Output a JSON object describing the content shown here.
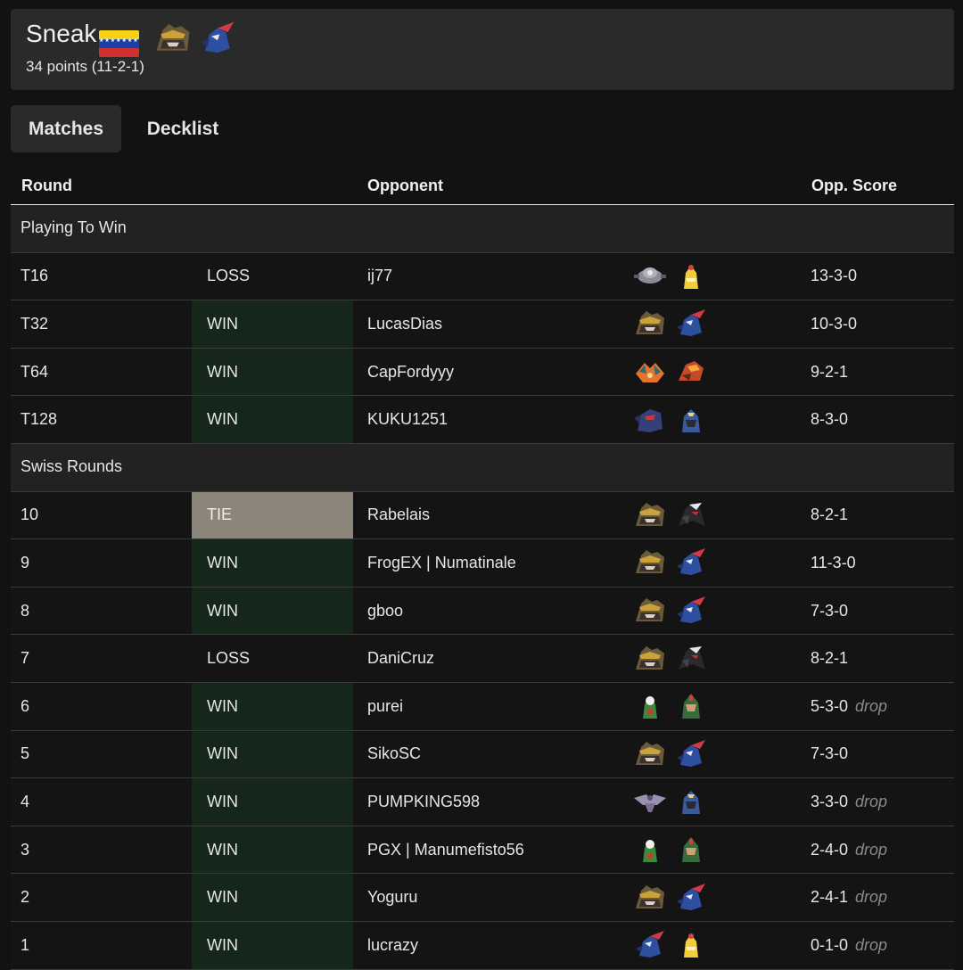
{
  "player": {
    "name": "Sneak",
    "flag": "venezuela-flag",
    "points": "34 points (11-2-1)",
    "deck_icons": [
      "giratina-icon",
      "greninja-icon"
    ]
  },
  "tabs": [
    {
      "label": "Matches",
      "active": true
    },
    {
      "label": "Decklist",
      "active": false
    }
  ],
  "table_headers": {
    "round": "Round",
    "opponent": "Opponent",
    "opp_score": "Opp. Score"
  },
  "colors": {
    "win_bg": "#15261a",
    "tie_bg": "#8c857a",
    "header_bg": "#2a2a2b",
    "page_bg": "#121212"
  },
  "sections": [
    {
      "label": "Playing To Win",
      "rows": [
        {
          "round": "T16",
          "result": "LOSS",
          "opponent": "ij77",
          "deck": [
            "magnezone-icon",
            "ampharos-icon"
          ],
          "score": "13-3-0",
          "drop": ""
        },
        {
          "round": "T32",
          "result": "WIN",
          "opponent": "LucasDias",
          "deck": [
            "giratina-icon",
            "greninja-icon"
          ],
          "score": "10-3-0",
          "drop": ""
        },
        {
          "round": "T64",
          "result": "WIN",
          "opponent": "CapFordyyy",
          "deck": [
            "charizard-icon",
            "pidgeot-icon"
          ],
          "score": "9-2-1",
          "drop": ""
        },
        {
          "round": "T128",
          "result": "WIN",
          "opponent": "KUKU1251",
          "deck": [
            "garchomp-icon",
            "lucario-icon"
          ],
          "score": "8-3-0",
          "drop": ""
        }
      ]
    },
    {
      "label": "Swiss Rounds",
      "rows": [
        {
          "round": "10",
          "result": "TIE",
          "opponent": "Rabelais",
          "deck": [
            "giratina-icon",
            "darkrai-icon"
          ],
          "score": "8-2-1",
          "drop": ""
        },
        {
          "round": "9",
          "result": "WIN",
          "opponent": "FrogEX | Numatinale",
          "deck": [
            "giratina-icon",
            "greninja-icon"
          ],
          "score": "11-3-0",
          "drop": ""
        },
        {
          "round": "8",
          "result": "WIN",
          "opponent": "gboo",
          "deck": [
            "giratina-icon",
            "greninja-icon"
          ],
          "score": "7-3-0",
          "drop": ""
        },
        {
          "round": "7",
          "result": "LOSS",
          "opponent": "DaniCruz",
          "deck": [
            "giratina-icon",
            "darkrai-icon"
          ],
          "score": "8-2-1",
          "drop": ""
        },
        {
          "round": "6",
          "result": "WIN",
          "opponent": "purei",
          "deck": [
            "grass-starter-icon",
            "decidueye-icon"
          ],
          "score": "5-3-0",
          "drop": "drop"
        },
        {
          "round": "5",
          "result": "WIN",
          "opponent": "SikoSC",
          "deck": [
            "giratina-icon",
            "greninja-icon"
          ],
          "score": "7-3-0",
          "drop": ""
        },
        {
          "round": "4",
          "result": "WIN",
          "opponent": "PUMPKING598",
          "deck": [
            "aerodactyl-icon",
            "lucario-icon"
          ],
          "score": "3-3-0",
          "drop": "drop"
        },
        {
          "round": "3",
          "result": "WIN",
          "opponent": "PGX | Manumefisto56",
          "deck": [
            "grass-starter-icon",
            "decidueye-icon"
          ],
          "score": "2-4-0",
          "drop": "drop"
        },
        {
          "round": "2",
          "result": "WIN",
          "opponent": "Yoguru",
          "deck": [
            "giratina-icon",
            "greninja-icon"
          ],
          "score": "2-4-1",
          "drop": "drop"
        },
        {
          "round": "1",
          "result": "WIN",
          "opponent": "lucrazy",
          "deck": [
            "greninja-icon",
            "ampharos-icon"
          ],
          "score": "0-1-0",
          "drop": "drop"
        }
      ]
    }
  ]
}
